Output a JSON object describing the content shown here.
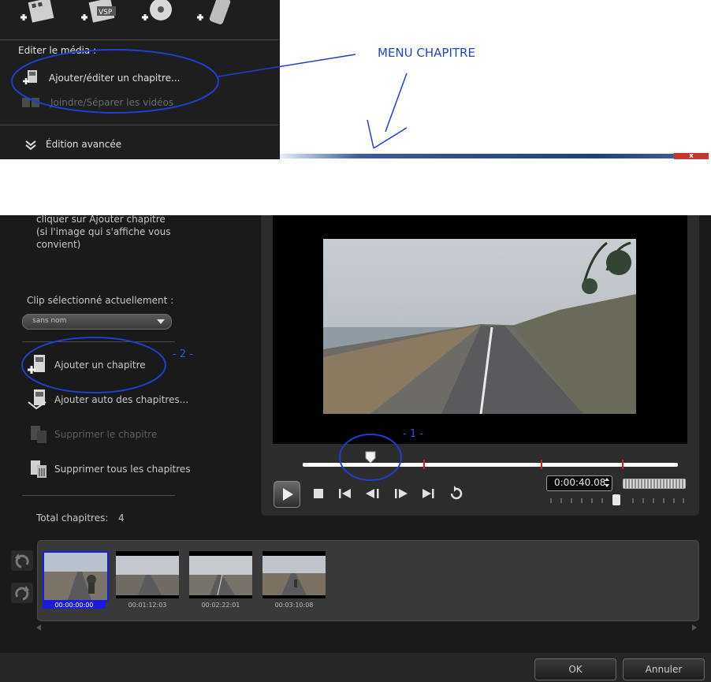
{
  "top_panel": {
    "section_label": "Editer le média :",
    "items": [
      {
        "label": "Ajouter/éditer un chapitre..."
      },
      {
        "label": "Joindre/Séparer les vidéos"
      }
    ],
    "advanced_label": "Édition avancée",
    "media_icons": [
      "add-video-icon",
      "add-vsp-icon",
      "add-disc-icon",
      "add-device-icon"
    ],
    "vsp_badge": "VSP"
  },
  "annotations": {
    "menu_label": "MENU CHAPITRE",
    "step_1": "- 1 -",
    "step_2": "- 2 -",
    "color": "#2244cc"
  },
  "dialog": {
    "instruction_lines": [
      "cliquer sur Ajouter chapitre",
      "(si l'image qui s'affiche vous",
      "convient)"
    ],
    "clip_label": "Clip sélectionné actuellement :",
    "clip_value": "sans nom",
    "actions": [
      {
        "label": "Ajouter un chapitre",
        "enabled": true
      },
      {
        "label": "Ajouter auto des chapitres...",
        "enabled": true
      },
      {
        "label": "Supprimer le chapitre",
        "enabled": false
      },
      {
        "label": "Supprimer tous les chapitres",
        "enabled": true
      }
    ],
    "total_label": "Total chapitres:",
    "total_value": "4",
    "timecode": "0:00:40.08",
    "thumbnails": [
      {
        "time": "00:00:00:00",
        "selected": true
      },
      {
        "time": "00:01:12:03",
        "selected": false
      },
      {
        "time": "00:02:22:01",
        "selected": false
      },
      {
        "time": "00:03:10:08",
        "selected": false
      }
    ],
    "ok_label": "OK",
    "cancel_label": "Annuler",
    "close_label": "x"
  }
}
